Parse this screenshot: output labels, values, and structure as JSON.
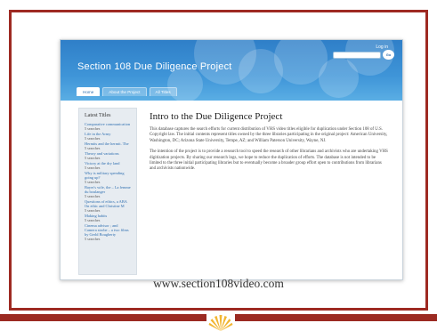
{
  "website": {
    "site_title": "Section 108 Due Diligence Project",
    "login_label": "Log in",
    "search": {
      "placeholder": "",
      "button_label": "Go"
    },
    "tabs": [
      {
        "label": "Home",
        "active": true
      },
      {
        "label": "About the Project",
        "active": false
      },
      {
        "label": "All Titles",
        "active": false
      }
    ],
    "sidebar": {
      "heading": "Latest Titles",
      "items": [
        {
          "title": "Comparative communication",
          "meta": "5 searches"
        },
        {
          "title": "Life in the Army",
          "meta": "5 searches"
        },
        {
          "title": "Hermits and the hermit. The",
          "meta": "5 searches"
        },
        {
          "title": "Theory and variations",
          "meta": "5 searches"
        },
        {
          "title": "Victory at the dry land",
          "meta": "5 searches"
        },
        {
          "title": "Why is military spending going up?",
          "meta": "5 searches"
        },
        {
          "title": "Bayer's wife, the – La femme du boulanger",
          "meta": "5 searches"
        },
        {
          "title": "Questions of ethics, a ABA On ethic and Christine M",
          "meta": "5 searches"
        },
        {
          "title": "Making habits",
          "meta": "5 searches"
        },
        {
          "title": "Cinema advisor ; and Camera strobe – a two films by Gerld Bougherty",
          "meta": "5 searches"
        }
      ]
    },
    "main": {
      "title": "Intro to the Due Diligence Project",
      "paragraphs": [
        "This database captures the search efforts for current distribution of VHS video titles eligible for duplication under Section 108 of U.S. Copyright law. The initial contents represent titles owned by the three libraries participating in the original project: American University, Washington, DC; Arizona State University, Tempe, AZ; and William Paterson University, Wayne, NJ.",
        "The intention of the project is to provide a research tool to speed the research of other librarians and archivists who are undertaking VHS digitization projects. By sharing our research logs, we hope to reduce the duplication of efforts. The database is not intended to be limited to the three initial participating libraries but to eventually become a broader group effort open to contributions from librarians and archivists nationwide."
      ]
    }
  },
  "slide": {
    "url_text": "www.section108video.com",
    "colors": {
      "frame": "#9e2a22",
      "banner": "#3a8cd3",
      "logo": "#f2b632"
    }
  }
}
